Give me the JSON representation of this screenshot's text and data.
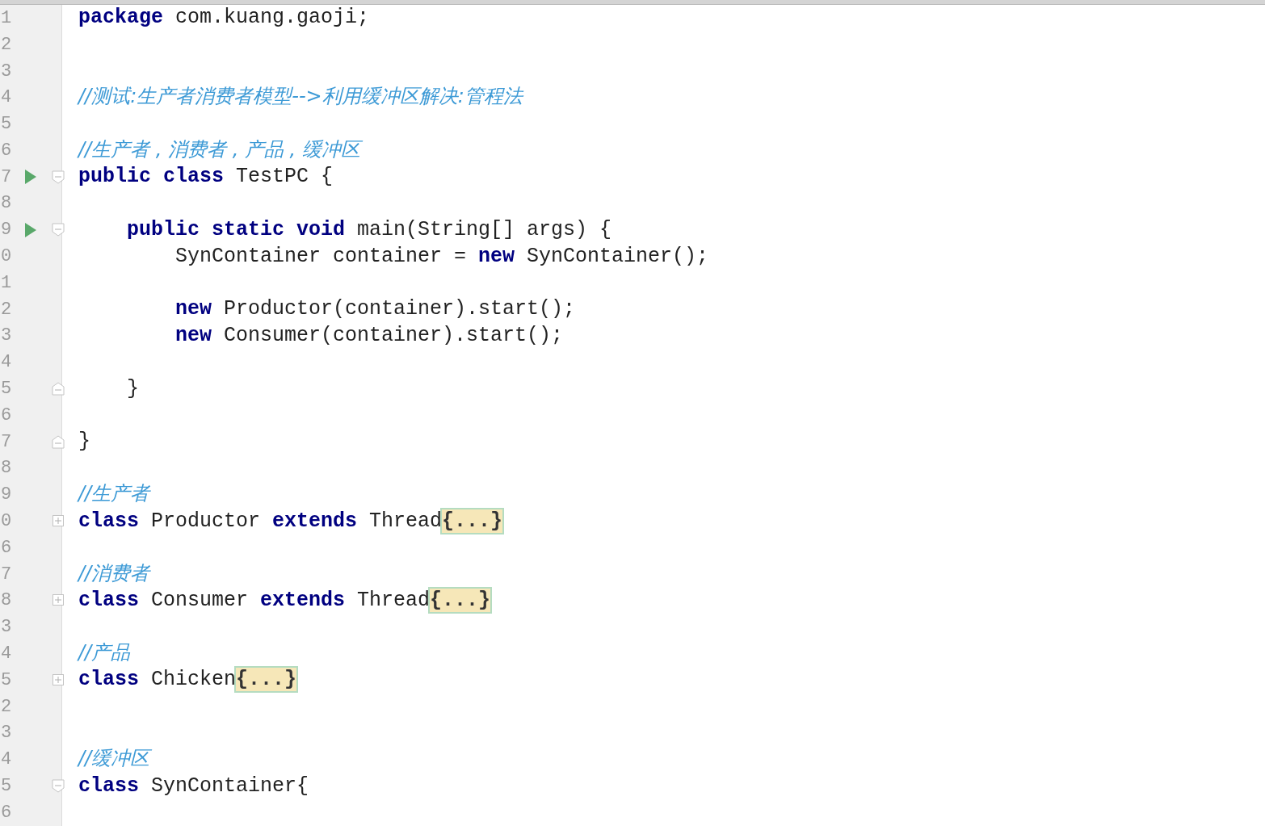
{
  "editor": {
    "lines": [
      {
        "number": "1",
        "tokens": [
          {
            "kind": "keyword",
            "text": "package"
          },
          {
            "kind": "plain",
            "text": " com.kuang.gaoji;"
          }
        ]
      },
      {
        "number": "2"
      },
      {
        "number": "3"
      },
      {
        "number": "4",
        "tokens": [
          {
            "kind": "comment",
            "text": "//测试:生产者消费者模型-->利用缓冲区解决:管程法"
          }
        ]
      },
      {
        "number": "5"
      },
      {
        "number": "6",
        "tokens": [
          {
            "kind": "comment",
            "text": "//生产者 , 消费者 , 产品 , 缓冲区"
          }
        ]
      },
      {
        "number": "7",
        "run": true,
        "expanded": true,
        "tokens": [
          {
            "kind": "keyword",
            "text": "public class"
          },
          {
            "kind": "plain",
            "text": " TestPC {"
          }
        ],
        "children": [
          {
            "number": "8"
          },
          {
            "number": "9",
            "run": true,
            "expanded": true,
            "tokens": [
              {
                "kind": "keyword",
                "text": "public static void"
              },
              {
                "kind": "plain",
                "text": " main(String[] args) {"
              }
            ],
            "children": [
              {
                "number": "0",
                "tokens": [
                  {
                    "kind": "plain",
                    "text": "SynContainer container = "
                  },
                  {
                    "kind": "keyword",
                    "text": "new"
                  },
                  {
                    "kind": "plain",
                    "text": " SynContainer();"
                  }
                ]
              },
              {
                "number": "1"
              },
              {
                "number": "2",
                "tokens": [
                  {
                    "kind": "keyword",
                    "text": "new"
                  },
                  {
                    "kind": "plain",
                    "text": " Productor(container).start();"
                  }
                ]
              },
              {
                "number": "3",
                "tokens": [
                  {
                    "kind": "keyword",
                    "text": "new"
                  },
                  {
                    "kind": "plain",
                    "text": " Consumer(container).start();"
                  }
                ]
              },
              {
                "number": "4"
              }
            ]
          },
          {
            "number": "5",
            "fold_end": true,
            "tokens": [
              {
                "kind": "plain",
                "text": "}"
              }
            ]
          },
          {
            "number": "6"
          }
        ]
      },
      {
        "number": "7",
        "fold_end": true,
        "tokens": [
          {
            "kind": "plain",
            "text": "}"
          }
        ]
      },
      {
        "number": "8"
      },
      {
        "number": "9",
        "tokens": [
          {
            "kind": "comment",
            "text": "//生产者"
          }
        ]
      },
      {
        "number": "0",
        "expanded": false,
        "tokens": [
          {
            "kind": "keyword",
            "text": "class"
          },
          {
            "kind": "plain",
            "text": " Productor "
          },
          {
            "kind": "keyword",
            "text": "extends"
          },
          {
            "kind": "plain",
            "text": " Thread"
          },
          {
            "kind": "folded",
            "text": "{...}"
          }
        ]
      },
      {
        "number": "6"
      },
      {
        "number": "7",
        "tokens": [
          {
            "kind": "comment",
            "text": "//消费者"
          }
        ]
      },
      {
        "number": "8",
        "expanded": false,
        "tokens": [
          {
            "kind": "keyword",
            "text": "class"
          },
          {
            "kind": "plain",
            "text": " Consumer "
          },
          {
            "kind": "keyword",
            "text": "extends"
          },
          {
            "kind": "plain",
            "text": " Thread"
          },
          {
            "kind": "folded",
            "text": "{...}"
          }
        ]
      },
      {
        "number": "3"
      },
      {
        "number": "4",
        "tokens": [
          {
            "kind": "comment",
            "text": "//产品"
          }
        ]
      },
      {
        "number": "5",
        "expanded": false,
        "tokens": [
          {
            "kind": "keyword",
            "text": "class"
          },
          {
            "kind": "plain",
            "text": " Chicken"
          },
          {
            "kind": "folded",
            "text": "{...}"
          }
        ]
      },
      {
        "number": "2"
      },
      {
        "number": "3"
      },
      {
        "number": "4",
        "tokens": [
          {
            "kind": "comment",
            "text": "//缓冲区"
          }
        ]
      },
      {
        "number": "5",
        "expanded": true,
        "tokens": [
          {
            "kind": "keyword",
            "text": "class"
          },
          {
            "kind": "plain",
            "text": " SynContainer{"
          }
        ]
      },
      {
        "number": "6"
      }
    ]
  }
}
